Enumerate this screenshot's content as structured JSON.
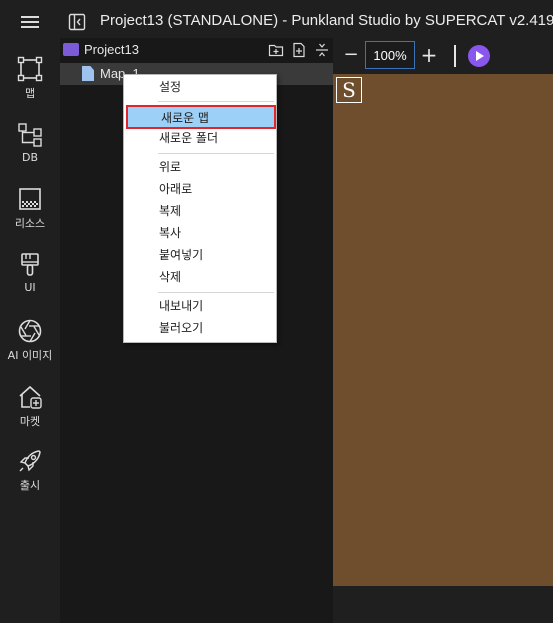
{
  "window": {
    "title": "Project13 (STANDALONE) - Punkland Studio by SUPERCAT v2.419"
  },
  "nav": {
    "items": [
      {
        "label": "맵",
        "icon": "map-icon"
      },
      {
        "label": "DB",
        "icon": "database-icon"
      },
      {
        "label": "리소스",
        "icon": "resource-icon"
      },
      {
        "label": "UI",
        "icon": "ui-brush-icon"
      },
      {
        "label": "AI 이미지",
        "icon": "ai-image-icon"
      },
      {
        "label": "마켓",
        "icon": "market-icon"
      },
      {
        "label": "출시",
        "icon": "rocket-icon"
      }
    ]
  },
  "project": {
    "name": "Project13",
    "tree": [
      {
        "label": "Map_1",
        "icon": "file-icon"
      }
    ]
  },
  "canvas_toolbar": {
    "zoom": "100%",
    "minus": "−",
    "plus": "+"
  },
  "canvas": {
    "marker": "S",
    "background": "#6e4e2d"
  },
  "context_menu": {
    "items": [
      {
        "label": "설정"
      },
      {
        "label": "새로운 맵",
        "highlighted": true
      },
      {
        "label": "새로운 폴더"
      },
      {
        "label": "위로"
      },
      {
        "label": "아래로"
      },
      {
        "label": "복제"
      },
      {
        "label": "복사"
      },
      {
        "label": "붙여넣기"
      },
      {
        "label": "삭제"
      },
      {
        "label": "내보내기"
      },
      {
        "label": "불러오기"
      }
    ]
  },
  "colors": {
    "accent": "#8a57ee",
    "selection": "#9cd0f6",
    "highlight_border": "#e0262b"
  }
}
